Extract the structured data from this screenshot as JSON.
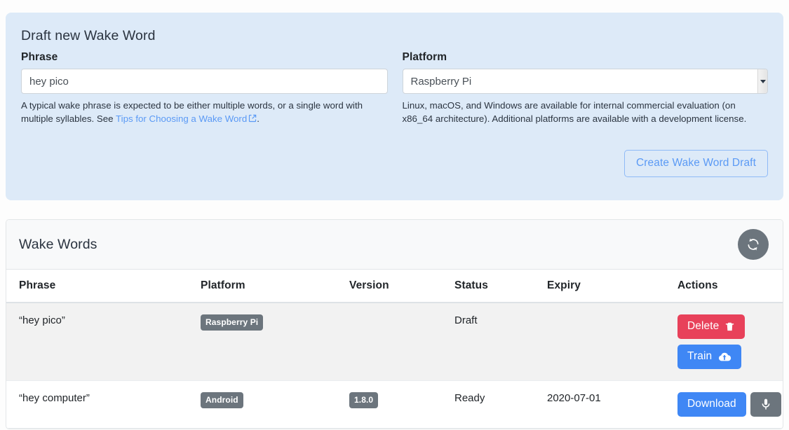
{
  "draft": {
    "title": "Draft new Wake Word",
    "phrase": {
      "label": "Phrase",
      "value": "hey pico",
      "placeholder": "hey pico",
      "helper_before": "A typical wake phrase is expected to be either multiple words, or a single word with multiple syllables. See ",
      "helper_link": "Tips for Choosing a Wake Word",
      "helper_after": "."
    },
    "platform": {
      "label": "Platform",
      "value": "Raspberry Pi",
      "helper": "Linux, macOS, and Windows are available for internal commercial evaluation (on x86_64 architecture). Additional platforms are available with a development license."
    },
    "create_button": "Create Wake Word Draft"
  },
  "list": {
    "title": "Wake Words",
    "refresh_icon": "refresh-icon",
    "columns": [
      "Phrase",
      "Platform",
      "Version",
      "Status",
      "Expiry",
      "Actions"
    ],
    "rows": [
      {
        "phrase": "“hey pico”",
        "platform": "Raspberry Pi",
        "version": "",
        "status": "Draft",
        "expiry": "",
        "actions": [
          {
            "label": "Delete",
            "style": "danger",
            "icon": "trash-icon"
          },
          {
            "label": "Train",
            "style": "primary",
            "icon": "cloud-upload-icon"
          }
        ],
        "layout": "stack",
        "striped": true
      },
      {
        "phrase": "“hey computer”",
        "platform": "Android",
        "version": "1.8.0",
        "status": "Ready",
        "expiry": "2020-07-01",
        "actions": [
          {
            "label": "Download",
            "style": "primary",
            "icon": ""
          },
          {
            "label": "",
            "style": "secondary",
            "icon": "microphone-icon"
          }
        ],
        "layout": "inline",
        "striped": false
      }
    ]
  },
  "colors": {
    "card_bg": "#ddeaf8",
    "link": "#5b9af5",
    "danger": "#e8415a",
    "primary": "#3f87f5",
    "secondary": "#6c757d"
  }
}
